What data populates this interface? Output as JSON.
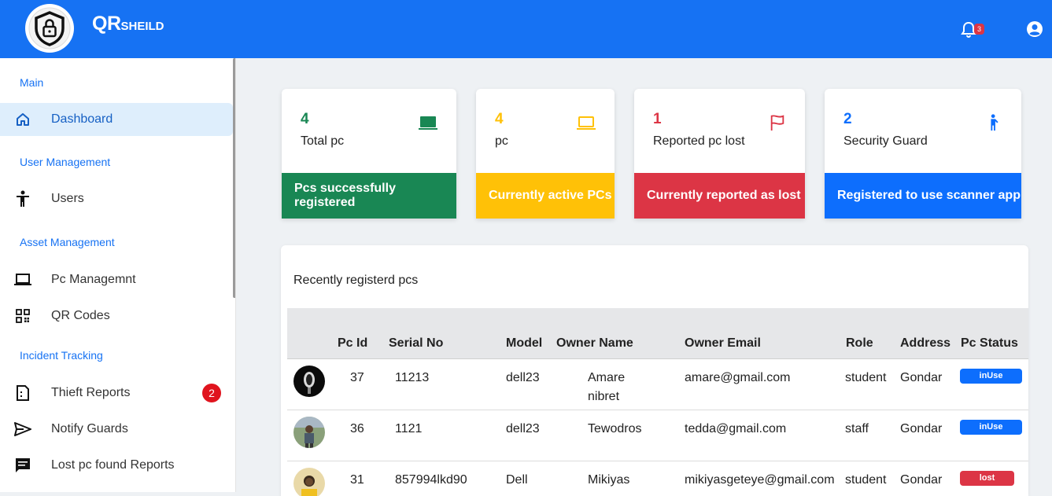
{
  "app": {
    "brand_main": "QR",
    "brand_sub": "SHEILD"
  },
  "header": {
    "notification_count": "3"
  },
  "sidebar": {
    "sections": {
      "main": "Main",
      "user_management": "User Management",
      "asset_management": "Asset Management",
      "incident_tracking": "Incident Tracking"
    },
    "items": {
      "dashboard": "Dashboard",
      "users": "Users",
      "pc_management": "Pc Managemnt",
      "qr_codes": "QR Codes",
      "thieft_reports": "Thieft Reports",
      "thieft_reports_count": "2",
      "notify_guards": "Notify Guards",
      "lost_pc_found": "Lost pc found Reports"
    }
  },
  "cards": [
    {
      "value": "4",
      "title": "Total pc",
      "footer": "Pcs successfully registered",
      "color": "#198754",
      "icon": "laptop-icon"
    },
    {
      "value": "4",
      "title": "pc",
      "footer": "Currently active PCs",
      "color": "#ffc107",
      "icon": "laptop-outline-icon"
    },
    {
      "value": "1",
      "title": "Reported pc lost",
      "footer": "Currently reported as lost",
      "color": "#dc3545",
      "icon": "flag-icon"
    },
    {
      "value": "2",
      "title": "Security Guard",
      "footer": "Registered to use scanner app",
      "color": "#0d6efd",
      "icon": "person-icon"
    }
  ],
  "table": {
    "title": "Recently registerd pcs",
    "headers": [
      "Pc Id",
      "Serial No",
      "Model",
      "Owner Name",
      "Owner Email",
      "Role",
      "Address",
      "Pc Status"
    ],
    "rows": [
      {
        "pc_id": "37",
        "serial": "11213",
        "model": "dell23",
        "owner_line1": "Amare",
        "owner_line2": "nibret",
        "email": "amare@gmail.com",
        "role": "student",
        "address": "Gondar",
        "status": "inUse"
      },
      {
        "pc_id": "36",
        "serial": "1121",
        "model": "dell23",
        "owner_line1": "Tewodros",
        "owner_line2": "",
        "email": "tedda@gmail.com",
        "role": "staff",
        "address": "Gondar",
        "status": "inUse"
      },
      {
        "pc_id": "31",
        "serial": "857994lkd90",
        "model": "Dell",
        "owner_line1": "Mikiyas",
        "owner_line2": "",
        "email": "mikiyasgeteye@gmail.com",
        "role": "student",
        "address": "Gondar",
        "status": "lost"
      }
    ]
  },
  "colors": {
    "primary": "#1672f3",
    "success": "#198754",
    "warning": "#ffc107",
    "danger": "#dc3545",
    "info": "#0d6efd"
  }
}
